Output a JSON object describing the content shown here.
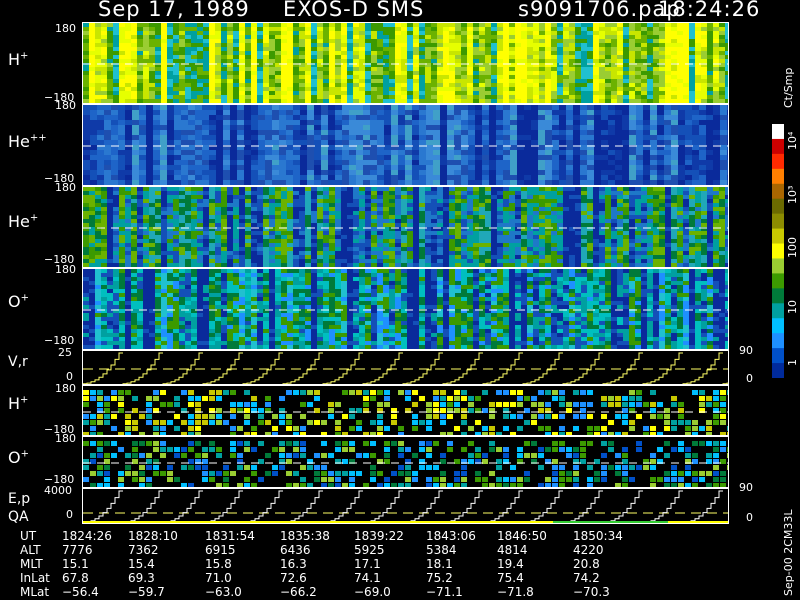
{
  "header": {
    "date": "Sep 17, 1989",
    "instrument": "EXOS-D SMS",
    "file": "s9091706.pap",
    "time": "18:24:26"
  },
  "panels": [
    {
      "id": "h",
      "base": "H",
      "sup": "+",
      "top_tick": "180",
      "bot_tick": "−180"
    },
    {
      "id": "hepp",
      "base": "He",
      "sup": "++",
      "top_tick": "180",
      "bot_tick": "−180"
    },
    {
      "id": "hep",
      "base": "He",
      "sup": "+",
      "top_tick": "180",
      "bot_tick": "−180"
    },
    {
      "id": "op",
      "base": "O",
      "sup": "+",
      "top_tick": "180",
      "bot_tick": "−180"
    }
  ],
  "vr": {
    "label": "V,r",
    "left_top": "25",
    "left_bot": "0",
    "right_top": "90",
    "right_bot": "0"
  },
  "h2": {
    "base": "H",
    "sup": "+",
    "top_tick": "180",
    "bot_tick": "−180"
  },
  "o2": {
    "base": "O",
    "sup": "+",
    "top_tick": "180",
    "bot_tick": "−180"
  },
  "ep": {
    "label1": "E,p",
    "label2": "QA",
    "left_top": "4000",
    "left_bot": "0",
    "right_top": "90",
    "right_bot": "0"
  },
  "colorbar": {
    "unit": "Ct/Smp",
    "labels": [
      "10⁴",
      "10³",
      "100",
      "10",
      "1"
    ],
    "colors": [
      "#ffffff",
      "#cc0000",
      "#ff2a00",
      "#ff7f00",
      "#aa6600",
      "#6b6a00",
      "#8b8b00",
      "#c8c800",
      "#ffff00",
      "#9acd32",
      "#3c9a00",
      "#007a3a",
      "#00a0a0",
      "#00bfff",
      "#1e90ff",
      "#0050c8",
      "#002a9b"
    ]
  },
  "footer": {
    "rows": [
      {
        "label": "UT",
        "values": [
          "1824:26",
          "1828:10",
          "1831:54",
          "1835:38",
          "1839:22",
          "1843:06",
          "1846:50",
          "1850:34"
        ]
      },
      {
        "label": "ALT",
        "values": [
          "7776",
          "7362",
          "6915",
          "6436",
          "5925",
          "5384",
          "4814",
          "4220"
        ]
      },
      {
        "label": "MLT",
        "values": [
          "15.1",
          "15.4",
          "15.8",
          "16.3",
          "17.1",
          "18.1",
          "19.4",
          "20.8"
        ]
      },
      {
        "label": "InLat",
        "values": [
          "67.8",
          "69.3",
          "71.0",
          "72.6",
          "74.1",
          "75.2",
          "75.4",
          "74.2"
        ]
      },
      {
        "label": "MLat",
        "values": [
          "−56.4",
          "−59.7",
          "−63.0",
          "−66.2",
          "−69.0",
          "−71.1",
          "−71.8",
          "−70.3"
        ]
      }
    ],
    "version": "Sep-00 2CM33L"
  },
  "colors": {
    "bg": "#000000",
    "axis": "#ffffff",
    "trace": "#ffff66",
    "qa": "#ffff00",
    "qa_green": "#33cc33"
  }
}
